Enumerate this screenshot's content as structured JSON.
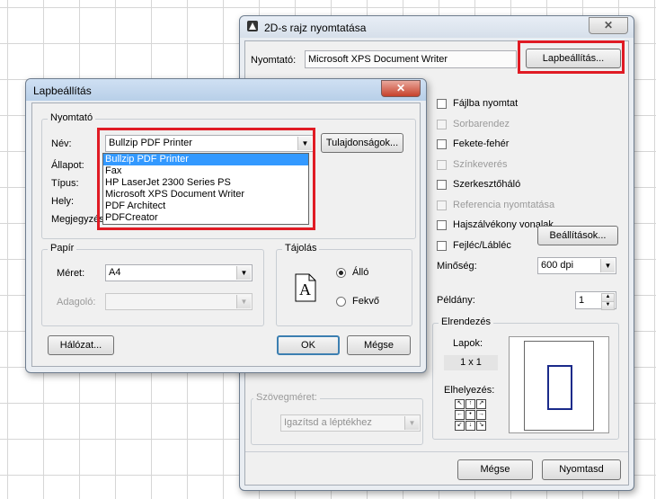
{
  "print_dialog": {
    "title": "2D-s rajz nyomtatása",
    "close": "✕",
    "printer_label": "Nyomtató:",
    "printer_value": "Microsoft XPS Document Writer",
    "page_setup_button": "Lapbeállítás...",
    "checkboxes": [
      {
        "label": "Fájlba nyomtat",
        "enabled": true
      },
      {
        "label": "Sorbarendez",
        "enabled": false
      },
      {
        "label": "Fekete-fehér",
        "enabled": true
      },
      {
        "label": "Színkeverés",
        "enabled": false
      },
      {
        "label": "Szerkesztőháló",
        "enabled": true
      },
      {
        "label": "Referencia nyomtatása",
        "enabled": false
      },
      {
        "label": "Hajszálvékony vonalak",
        "enabled": true
      },
      {
        "label": "Fejléc/Lábléc",
        "enabled": true
      }
    ],
    "header_settings_button": "Beállítások...",
    "quality_label": "Minőség:",
    "quality_value": "600 dpi",
    "copies_label": "Példány:",
    "copies_value": "1",
    "layout_group": "Elrendezés",
    "pages_label": "Lapok:",
    "pages_value": "1 x 1",
    "placement_label": "Elhelyezés:",
    "font_size_group": "Szövegméret:",
    "font_size_value": "Igazítsd a léptékhez",
    "cancel_button": "Mégse",
    "print_button": "Nyomtasd"
  },
  "page_setup": {
    "title": "Lapbeállítás",
    "close": "✕",
    "printer_group": "Nyomtató",
    "name_label": "Név:",
    "name_value": "Bullzip PDF Printer",
    "properties_button": "Tulajdonságok...",
    "status_label": "Állapot:",
    "type_label": "Típus:",
    "location_label": "Hely:",
    "comment_label": "Megjegyzés:",
    "printer_options": [
      "Bullzip PDF Printer",
      "Fax",
      "HP LaserJet 2300 Series PS",
      "Microsoft XPS Document Writer",
      "PDF Architect",
      "PDFCreator"
    ],
    "selected_index": 0,
    "paper_group": "Papír",
    "size_label": "Méret:",
    "size_value": "A4",
    "source_label": "Adagoló:",
    "source_value": "",
    "orientation_group": "Tájolás",
    "orientation_glyph": "A",
    "portrait_label": "Álló",
    "landscape_label": "Fekvő",
    "network_button": "Hálózat...",
    "ok_button": "OK",
    "cancel_button": "Mégse"
  },
  "accent_color": "#e01b24",
  "selection_color": "#3399ff"
}
